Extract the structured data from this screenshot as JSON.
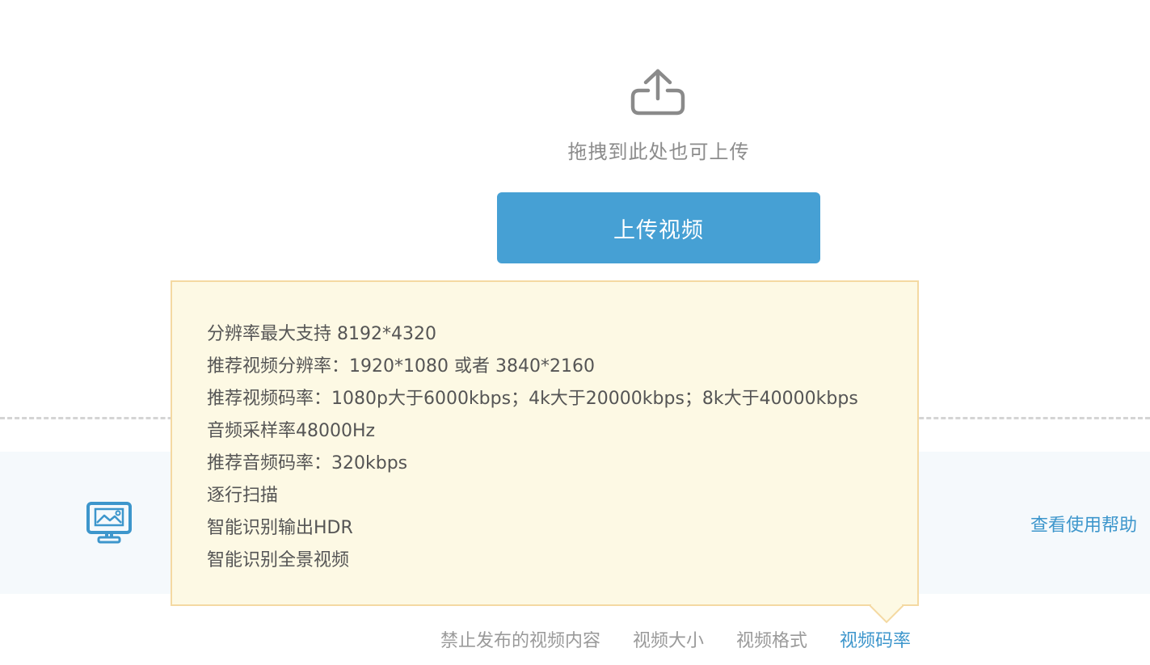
{
  "upload": {
    "icon": "upload-cloud-icon",
    "drag_hint": "拖拽到此处也可上传",
    "button_label": "上传视频"
  },
  "info_band": {
    "icon": "monitor-image-icon",
    "help_link": "查看使用帮助"
  },
  "tooltip": {
    "lines": [
      "分辨率最大支持 8192*4320",
      "推荐视频分辨率：1920*1080 或者 3840*2160",
      "推荐视频码率：1080p大于6000kbps；4k大于20000kbps；8k大于40000kbps",
      "音频采样率48000Hz",
      "推荐音频码率：320kbps",
      "逐行扫描",
      "智能识别输出HDR",
      "智能识别全景视频"
    ]
  },
  "tabs": [
    {
      "label": "禁止发布的视频内容",
      "active": false
    },
    {
      "label": "视频大小",
      "active": false
    },
    {
      "label": "视频格式",
      "active": false
    },
    {
      "label": "视频码率",
      "active": true
    }
  ],
  "colors": {
    "accent": "#46a0d4",
    "link": "#3d96cc",
    "tooltip_bg": "#fdf9e4",
    "tooltip_border": "#f4d9a2",
    "band_bg": "#f5f9fc"
  }
}
